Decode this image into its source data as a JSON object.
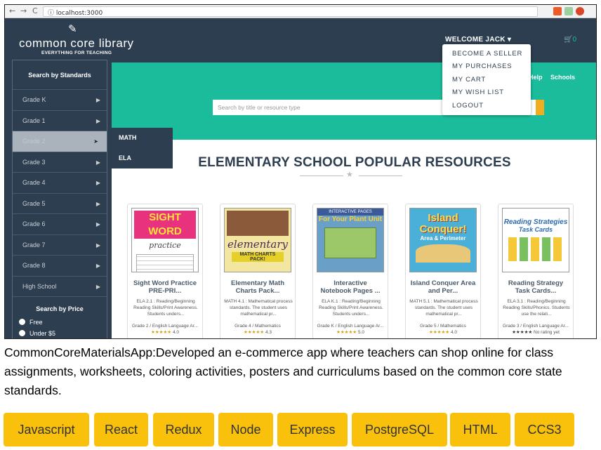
{
  "browser": {
    "url": "localhost:3000",
    "back": "←",
    "forward": "→",
    "reload": "C"
  },
  "header": {
    "logo_title": "common core library",
    "logo_subtitle": "EVERYTHING FOR TEACHING",
    "welcome": "WELCOME JACK ▾",
    "cart": "🛒0"
  },
  "user_menu": [
    "BECOME A SELLER",
    "MY PURCHASES",
    "MY CART",
    "MY WISH LIST",
    "LOGOUT"
  ],
  "sidebar": {
    "standards_heading": "Search by Standards",
    "grades": [
      "Grade K",
      "Grade 1",
      "Grade 2",
      "Grade 3",
      "Grade 4",
      "Grade 5",
      "Grade 6",
      "Grade 7",
      "Grade 8",
      "High School"
    ],
    "price_heading": "Search by Price",
    "price_options": [
      "Free",
      "Under $5"
    ]
  },
  "flyout": [
    "MATH",
    "ELA"
  ],
  "topnav": {
    "help": "Help",
    "schools": "Schools"
  },
  "search": {
    "placeholder": "Search by title or resource type"
  },
  "section_title": "ELEMENTARY SCHOOL POPULAR RESOURCES",
  "cards": [
    {
      "title1": "Sight Word Practice",
      "title2": "PRE-PRI...",
      "desc": "ELA 2.1 : Reading/Beginning Reading Skills/Print Awareness. Students unders...",
      "grade": "Grade 2 / English Language Ar...",
      "stars": "★★★★★",
      "rating": "4.0",
      "thumb_big": "SIGHT WORD",
      "thumb_small": "practice"
    },
    {
      "title1": "Elementary Math",
      "title2": "Charts Pack...",
      "desc": "MATH 4.1 : Mathematical process standards. The student uses mathematical pr...",
      "grade": "Grade 4 / Mathematics",
      "stars": "★★★★★",
      "rating": "4.3",
      "thumb_big": "elementary",
      "thumb_small": "MATH CHARTS PACK!"
    },
    {
      "title1": "Interactive",
      "title2": "Notebook Pages ...",
      "desc": "ELA K.1 : Reading/Beginning Reading Skills/Print Awareness. Students unders...",
      "grade": "Grade K / English Language Ar...",
      "stars": "★★★★★",
      "rating": "5.0",
      "thumb_big": "For Your Plant Unit",
      "thumb_small": "INTERACTIVE PAGES"
    },
    {
      "title1": "Island Conquer Area",
      "title2": "and Per...",
      "desc": "MATH 5.1 : Mathematical process standards. The student uses mathematical pr...",
      "grade": "Grade 5 / Mathematics",
      "stars": "★★★★★",
      "rating": "4.0",
      "thumb_big": "Island Conquer!",
      "thumb_small": "Area & Perimeter"
    },
    {
      "title1": "Reading Strategy",
      "title2": "Task Cards...",
      "desc": "ELA 3.1 : Reading/Beginning Reading Skills/Phonics. Students use the relati...",
      "grade": "Grade 3 / English Language Ar...",
      "stars": "★★★★★",
      "rating": "No rating yet",
      "thumb_big": "Reading Strategies",
      "thumb_small": "Task Cards"
    }
  ],
  "description": "CommonCoreMaterialsApp:Developed an e-commerce app where teachers can shop online for class assignments, worksheets, coloring activities, posters and curriculums based on the common core state standards.",
  "tags": [
    "Javascript",
    "React",
    "Redux",
    "Node",
    "Express",
    "PostgreSQL",
    "HTML",
    "CCS3"
  ],
  "colors": {
    "navy": "#2d3e50",
    "teal": "#1bbc9b",
    "tag_yellow": "#f9c10c"
  }
}
